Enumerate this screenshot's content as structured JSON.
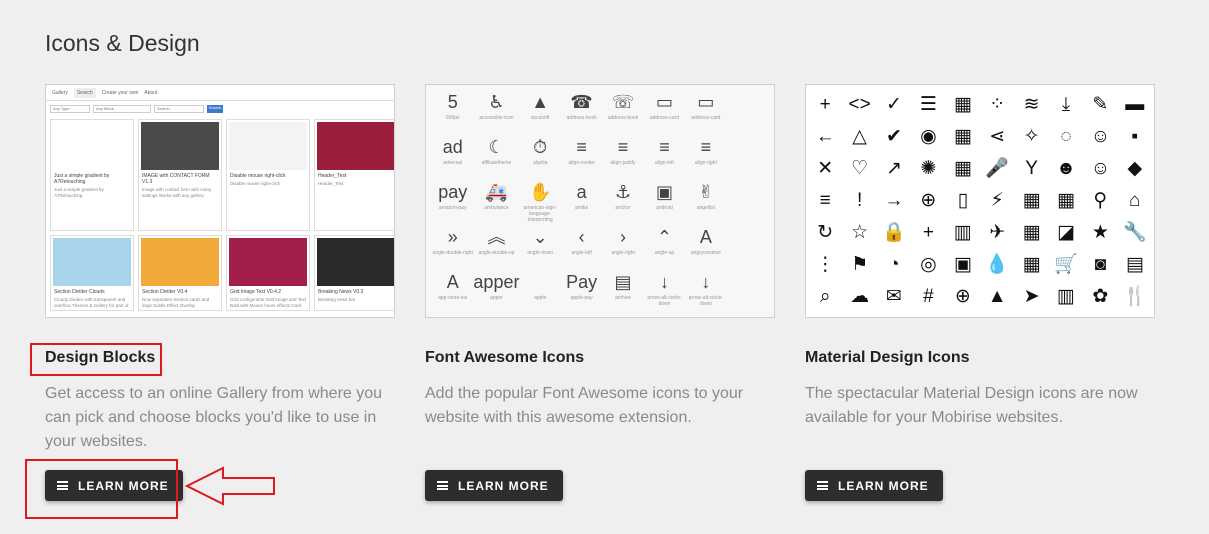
{
  "section": {
    "title": "Icons & Design"
  },
  "cards": [
    {
      "title": "Design Blocks",
      "description": "Get access to an online Gallery from where you can pick and choose blocks you'd like to use in your websites.",
      "button": "LEARN MORE",
      "gallery": {
        "nav": [
          "Gallery",
          "Search",
          "Create your own",
          "About"
        ],
        "filters": [
          "Any Type",
          "Any Block",
          "Search"
        ],
        "search_button": "Search",
        "items": [
          {
            "title": "Just a simple gradient by A7Retouching",
            "desc": "Just a simple gradient by A7Retouching",
            "color": "#ffffff"
          },
          {
            "title": "IMAGE with CONTACT FORM V1.3",
            "desc": "Image with contact form with many settings Works with any gallery",
            "color": "#4a4a4a"
          },
          {
            "title": "Disable mouse right-click",
            "desc": "Disable mouse right-click",
            "color": "#f3f3f3"
          },
          {
            "title": "Header_Test",
            "desc": "Header_Test",
            "color": "#9b1f3a"
          },
          {
            "title": "Section Divider Clouds",
            "desc": "Cloudy Divider with transparent and overflow Themes & Gallery for part of the block",
            "color": "#a8d4ec"
          },
          {
            "title": "Section Divider V0.4",
            "desc": "Now separates Section.cards and dogs Subtle Effect Overlay",
            "color": "#f2a93b"
          },
          {
            "title": "Grid Image Text V0.4.2",
            "desc": "Grid configurable Grid Image and Text Bold with Mouse hover effects Card Color",
            "color": "#a21f4a"
          },
          {
            "title": "Breaking News V0.3",
            "desc": "Breaking news bar",
            "color": "#2a2a2a"
          }
        ]
      }
    },
    {
      "title": "Font Awesome Icons",
      "description": "Add the popular Font Awesome icons to your website with this awesome extension.",
      "button": "LEARN MORE",
      "icons": [
        {
          "g": "5",
          "l": "500px"
        },
        {
          "g": "♿",
          "l": "accessible-icon"
        },
        {
          "g": "▲",
          "l": "accusoft"
        },
        {
          "g": "☎",
          "l": "address-book"
        },
        {
          "g": "☏",
          "l": "address-book"
        },
        {
          "g": "▭",
          "l": "address-card"
        },
        {
          "g": "▭",
          "l": "address-card"
        },
        {
          "g": "",
          "l": ""
        },
        {
          "g": "ad",
          "l": "adversal"
        },
        {
          "g": "☾",
          "l": "affiliatetheme"
        },
        {
          "g": "⏱",
          "l": "algolia"
        },
        {
          "g": "≡",
          "l": "align-center"
        },
        {
          "g": "≡",
          "l": "align-justify"
        },
        {
          "g": "≡",
          "l": "align-left"
        },
        {
          "g": "≡",
          "l": "align-right"
        },
        {
          "g": "",
          "l": ""
        },
        {
          "g": "pay",
          "l": "amazon-pay"
        },
        {
          "g": "🚑",
          "l": "ambulance"
        },
        {
          "g": "✋",
          "l": "american-sign-language-interpreting"
        },
        {
          "g": "a",
          "l": "amilia"
        },
        {
          "g": "⚓",
          "l": "anchor"
        },
        {
          "g": "▣",
          "l": "android"
        },
        {
          "g": "✌",
          "l": "angellist"
        },
        {
          "g": "",
          "l": ""
        },
        {
          "g": "»",
          "l": "angle-double-right"
        },
        {
          "g": "︽",
          "l": "angle-double-up"
        },
        {
          "g": "⌄",
          "l": "angle-down"
        },
        {
          "g": "‹",
          "l": "angle-left"
        },
        {
          "g": "›",
          "l": "angle-right"
        },
        {
          "g": "⌃",
          "l": "angle-up"
        },
        {
          "g": "A",
          "l": "angrycreative"
        },
        {
          "g": "",
          "l": ""
        },
        {
          "g": "A",
          "l": "app-store-ios"
        },
        {
          "g": "apper",
          "l": "apper"
        },
        {
          "g": "",
          "l": "apple"
        },
        {
          "g": "Pay",
          "l": "apple-pay"
        },
        {
          "g": "▤",
          "l": "archive"
        },
        {
          "g": "↓",
          "l": "arrow-alt-circle-down"
        },
        {
          "g": "↓",
          "l": "arrow-alt-circle-down"
        },
        {
          "g": "",
          "l": ""
        }
      ]
    },
    {
      "title": "Material Design Icons",
      "description": "The spectacular Material Design icons are now available for your Mobirise websites.",
      "button": "LEARN MORE",
      "icons": [
        "+",
        "<>",
        "✓",
        "☰",
        "▦",
        "⁘",
        "≋",
        "⤓",
        "✎",
        "▬",
        "←",
        "△",
        "✔",
        "◉",
        "▦",
        "⋖",
        "✧",
        "◌",
        "☺",
        "▪",
        "✕",
        "♡",
        "↗",
        "✺",
        "▦",
        "🎤",
        "Y",
        "☻",
        "☺",
        "◆",
        "≡",
        "!",
        "→",
        "⊕",
        "▯",
        "⚡",
        "▦",
        "▦",
        "⚲",
        "⌂",
        "↻",
        "☆",
        "🔒",
        "+",
        "▥",
        "✈",
        "▦",
        "◪",
        "★",
        "🔧",
        "⋮",
        "⚑",
        "◔",
        "◎",
        "▣",
        "💧",
        "▦",
        "🛒",
        "◙",
        "▤",
        "⌕",
        "☁",
        "✉",
        "#",
        "⊕",
        "▲",
        "➤",
        "▥",
        "✿",
        "🍴"
      ]
    }
  ]
}
